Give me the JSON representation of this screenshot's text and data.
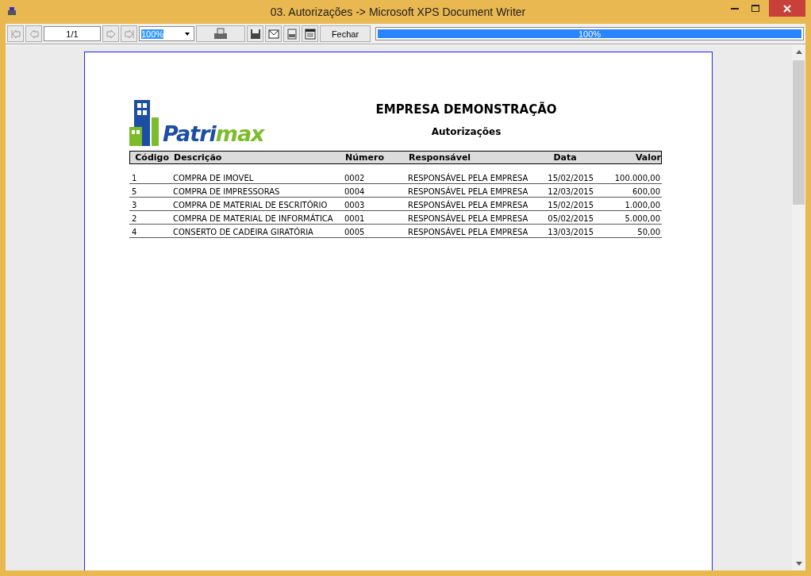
{
  "window": {
    "title": "03. Autorizações -> Microsoft XPS Document Writer"
  },
  "toolbar": {
    "page": "1/1",
    "zoom": "100%",
    "close_label": "Fechar",
    "progress": {
      "level": 1,
      "reading": "100%"
    }
  },
  "report": {
    "logo": [
      "Patri",
      "max"
    ],
    "company": "EMPRESA DEMONSTRAÇÃO",
    "title": "Autorizações",
    "columns": [
      "Código",
      "Descrição",
      "Número",
      "Responsável",
      "Data",
      "Valor"
    ],
    "rows": [
      [
        "1",
        "COMPRA DE IMOVEL",
        "0002",
        "RESPONSÁVEL PELA EMPRESA",
        "15/02/2015",
        "100.000,00"
      ],
      [
        "5",
        "COMPRA DE IMPRESSORAS",
        "0004",
        "RESPONSÁVEL PELA EMPRESA",
        "12/03/2015",
        "600,00"
      ],
      [
        "3",
        "COMPRA DE MATERIAL DE ESCRITÓRIO",
        "0003",
        "RESPONSÁVEL PELA EMPRESA",
        "15/02/2015",
        "1.000,00"
      ],
      [
        "2",
        "COMPRA DE MATERIAL DE INFORMÁTICA",
        "0001",
        "RESPONSÁVEL PELA EMPRESA",
        "05/02/2015",
        "5.000,00"
      ],
      [
        "4",
        "CONSERTO DE CADEIRA GIRATÓRIA",
        "0005",
        "RESPONSÁVEL PELA EMPRESA",
        "13/03/2015",
        "50,00"
      ]
    ]
  }
}
